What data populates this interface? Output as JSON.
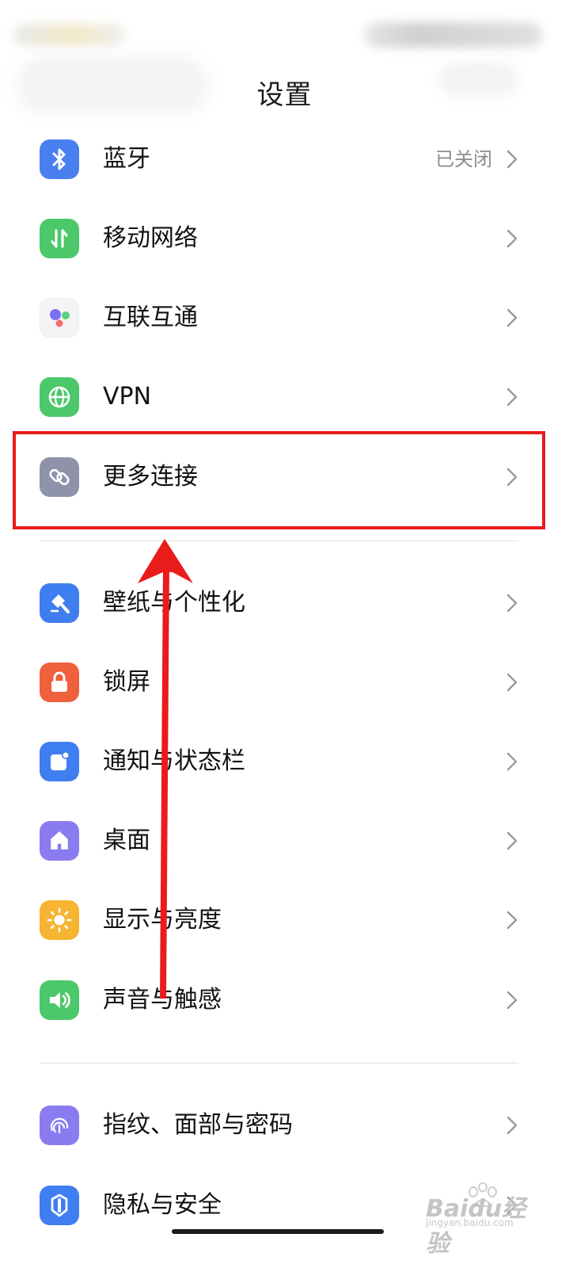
{
  "header": {
    "title": "设置"
  },
  "settings": {
    "group1": [
      {
        "label": "蓝牙",
        "value": "已关闭",
        "icon": "bluetooth-icon",
        "color": "#4a7ff0"
      },
      {
        "label": "移动网络",
        "icon": "mobile-data-icon",
        "color": "#4cc86a"
      },
      {
        "label": "互联互通",
        "icon": "interconnect-icon",
        "color": "#f4f4f6"
      },
      {
        "label": "VPN",
        "icon": "globe-icon",
        "color": "#4cc86a"
      },
      {
        "label": "更多连接",
        "icon": "link-icon",
        "color": "#8e93aa"
      }
    ],
    "group2": [
      {
        "label": "壁纸与个性化",
        "icon": "brush-icon",
        "color": "#3f7ef0"
      },
      {
        "label": "锁屏",
        "icon": "lock-icon",
        "color": "#f0603c"
      },
      {
        "label": "通知与状态栏",
        "icon": "notification-icon",
        "color": "#3f7ef0"
      },
      {
        "label": "桌面",
        "icon": "home-icon",
        "color": "#8a7cf0"
      },
      {
        "label": "显示与亮度",
        "icon": "brightness-icon",
        "color": "#f6b431"
      },
      {
        "label": "声音与触感",
        "icon": "speaker-icon",
        "color": "#4cc86a"
      }
    ],
    "group3": [
      {
        "label": "指纹、面部与密码",
        "icon": "fingerprint-icon",
        "color": "#8a7cf0"
      },
      {
        "label": "隐私与安全",
        "icon": "privacy-icon",
        "color": "#3f7ef0"
      }
    ]
  },
  "annotation": {
    "color": "#ea1b1b"
  },
  "watermark": {
    "main": "Baidu经验",
    "sub": "jingyan.baidu.com"
  }
}
